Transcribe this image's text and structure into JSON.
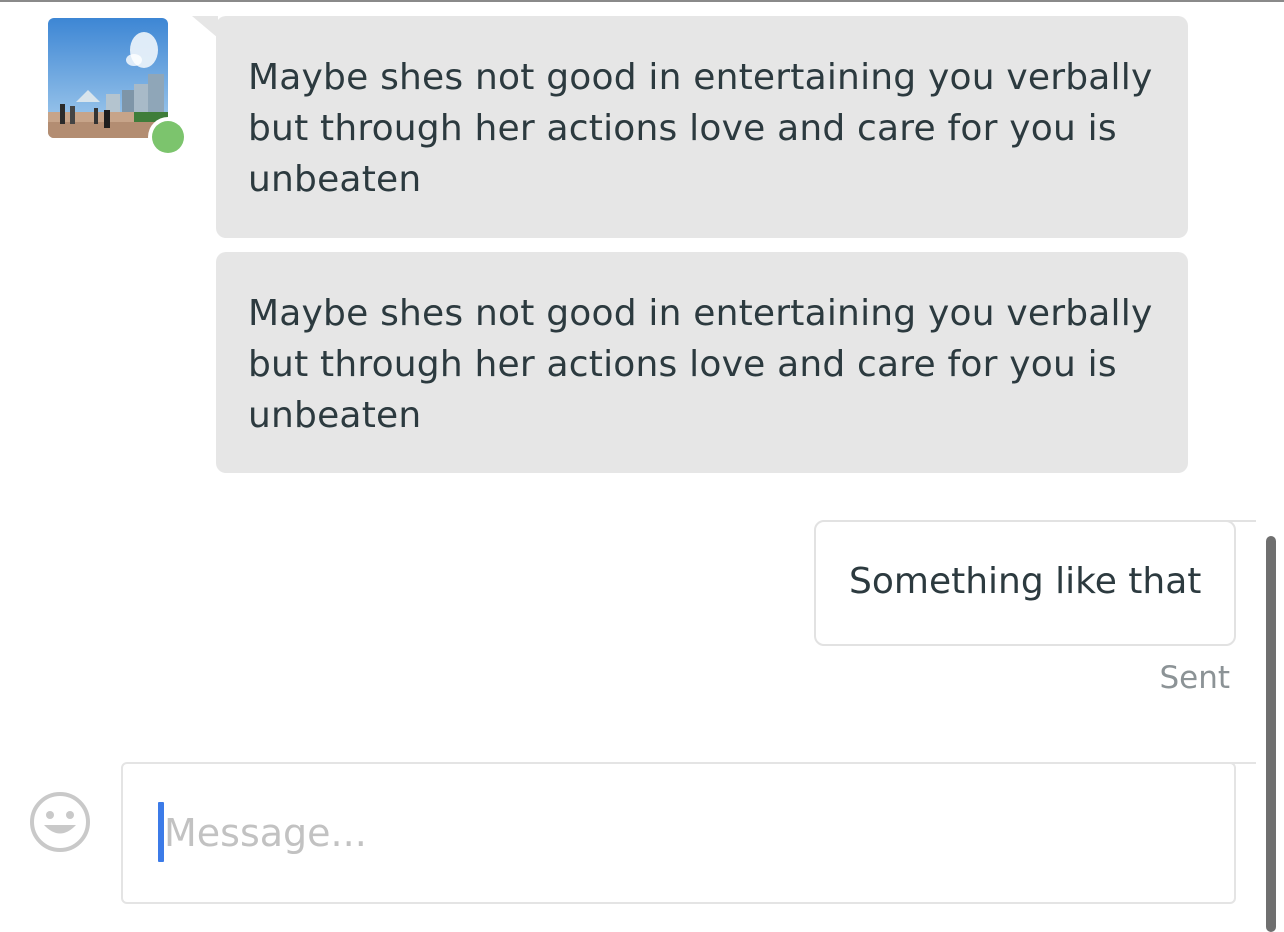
{
  "conversation": {
    "incoming": [
      {
        "text": "Maybe shes not good in entertaining you verbally but through her actions love and care for you is unbeaten"
      },
      {
        "text": "Maybe shes not good in entertaining you verbally but through her actions love and care for you is unbeaten"
      }
    ],
    "outgoing": [
      {
        "text": "Something like that",
        "status": "Sent"
      }
    ]
  },
  "sender": {
    "online": true,
    "presence_color": "#7cc46d"
  },
  "composer": {
    "placeholder": "Message...",
    "value": "",
    "emoji_icon": "smiley-face-icon"
  },
  "colors": {
    "incoming_bubble": "#e6e6e6",
    "text": "#2c3a3f",
    "status_text": "#8c9396",
    "caret": "#3c7be8"
  }
}
